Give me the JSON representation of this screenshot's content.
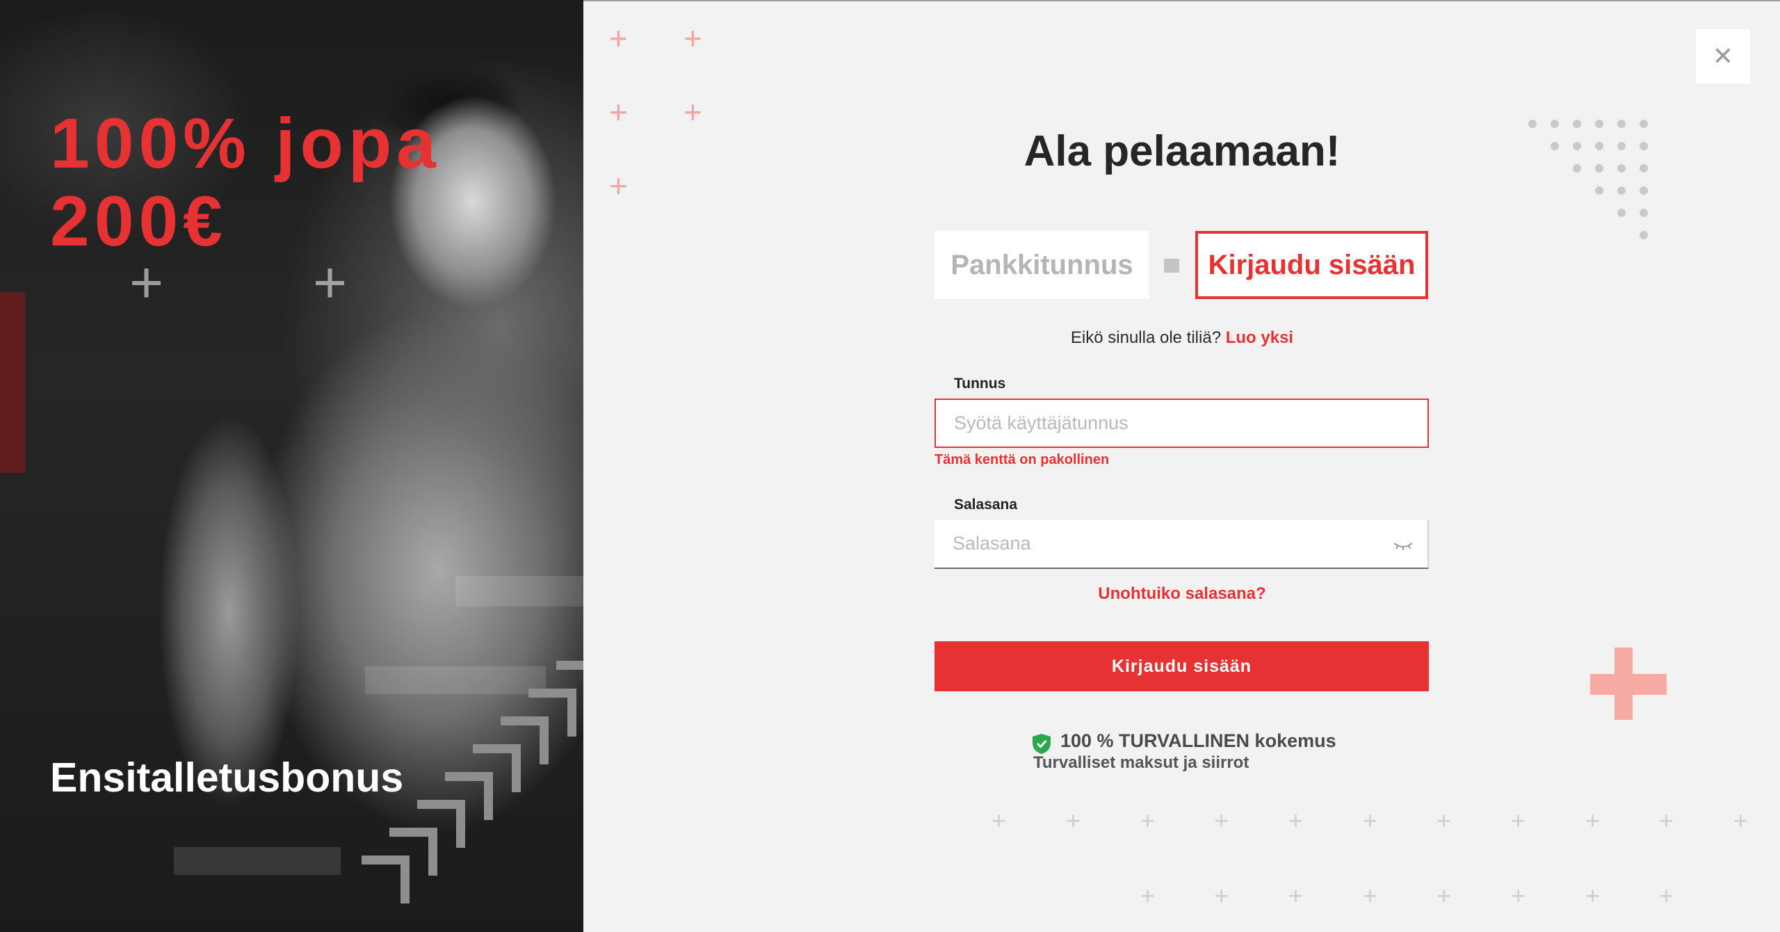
{
  "promo": {
    "headline_line1": "100% jopa",
    "headline_line2": "200€",
    "subline": "Ensitalletusbonus"
  },
  "dialog": {
    "title": "Ala pelaamaan!",
    "close_icon": "close-icon",
    "tabs": [
      {
        "label": "Pankkitunnus",
        "active": false
      },
      {
        "label": "Kirjaudu sisään",
        "active": true
      }
    ],
    "signup_prompt": "Eikö sinulla ole tiliä?",
    "signup_link": "Luo yksi",
    "username": {
      "label": "Tunnus",
      "placeholder": "Syötä käyttäjätunnus",
      "value": "",
      "error": "Tämä kenttä on pakollinen"
    },
    "password": {
      "label": "Salasana",
      "placeholder": "Salasana",
      "value": "",
      "toggle_icon": "eye-closed-icon"
    },
    "forgot_link": "Unohtuiko salasana?",
    "submit_label": "Kirjaudu sisään",
    "security": {
      "icon": "shield-check-icon",
      "title": "100 % TURVALLINEN kokemus",
      "subtitle": "Turvalliset maksut ja siirrot"
    }
  },
  "colors": {
    "accent": "#e63232",
    "background": "#f2f2f2",
    "shield": "#2aa84a"
  }
}
